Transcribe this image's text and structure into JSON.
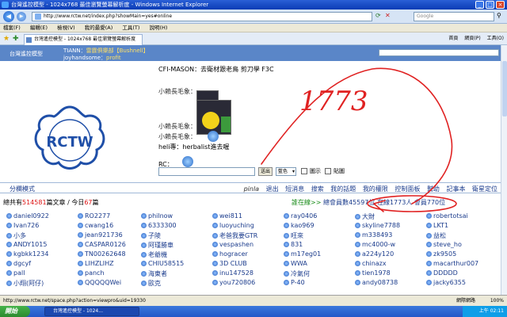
{
  "window": {
    "title": "台灣遙控模型 - 1024x768 最佳瀏覽螢幕解析度 - Windows Internet Explorer",
    "minimize": "_",
    "maximize": "□",
    "close": "×"
  },
  "address_bar": {
    "url": "http://www.rctw.net/index.php?showMain=yes#online",
    "search_placeholder": "Google"
  },
  "menu": [
    "檔案(F)",
    "編輯(E)",
    "檢視(V)",
    "我的最愛(A)",
    "工具(T)",
    "說明(H)"
  ],
  "tab": {
    "label": "台灣遙控模型 - 1024x768 最佳瀏覽螢幕解析度"
  },
  "toolbar": [
    "首頁",
    "網頁(P)",
    "工具(O)"
  ],
  "chat": {
    "header_title": "台灣遙控模型",
    "header_user1": "TIANN：",
    "header_msg1": "雷霆俱樂部【Bushnell】",
    "header_user2": "joyhandsome：",
    "header_msg2": "profit",
    "lines": [
      {
        "text": "CFI-MASON：去衛材跟老鳥 剪刀學 F3C"
      },
      {
        "text": "小賴長毛象："
      },
      {
        "text": "小賴長毛象："
      },
      {
        "text": "小賴長毛象："
      },
      {
        "text": "heli專：herbalist進去喔"
      },
      {
        "text": "RC："
      }
    ],
    "send_label": "送出",
    "color_label": "藍色",
    "opt1": "圖示",
    "opt2": "貼圖"
  },
  "nav": {
    "left": "分欄模式",
    "items": [
      "pinla",
      "退出",
      "短消息",
      "搜索",
      "我的話題",
      "我的權限",
      "控制面板",
      "幫助",
      "記事本",
      "衛星定位"
    ]
  },
  "stats": {
    "prefix": "總共有",
    "topics": "514581",
    "mid": "篇文章 / 今日",
    "today": "67",
    "suffix": "篇",
    "online_label": "誰在線>>",
    "online_total": "總會員數45597位",
    "online_now": "在線1773人",
    "online_members": "會員770位"
  },
  "users": [
    [
      "daniel0922",
      "RO2277",
      "philnow",
      "wei811",
      "ray0406",
      "大財",
      "robertotsai"
    ],
    [
      "Ivan726",
      "cwang16",
      "6333300",
      "luoyuching",
      "kao969",
      "skyline7788",
      "LKT1"
    ],
    [
      "小多",
      "jean921736",
      "子陵",
      "老爸我要GTR",
      "旺來",
      "m338493",
      "益松"
    ],
    [
      "ANDY1015",
      "CASPAR0126",
      "阿瑾勝車",
      "vespashen",
      "831",
      "mc4000-w",
      "steve_ho"
    ],
    [
      "kgbkk1234",
      "TN00262648",
      "老爺機",
      "hogracer",
      "m17eg01",
      "a224y120",
      "zk9505"
    ],
    [
      "dgcyf",
      "LIHZLIHZ",
      "CHIU58515",
      "3D CLUB",
      "WWA",
      "chinazx",
      "macarthur007"
    ],
    [
      "pall",
      "panch",
      "海東者",
      "inu147528",
      "冷氣何",
      "tien1978",
      "DDDDD"
    ],
    [
      "小翔(阿仔)",
      "QQQQQWei",
      "歐克",
      "you720806",
      "P-40",
      "andy08738",
      "jacky6355"
    ]
  ],
  "annotation": {
    "text": "1773"
  },
  "status": {
    "url": "http://www.rctw.net/space.php?action=viewpro&uid=19330",
    "zone": "網際網路",
    "zoom": "100%"
  },
  "taskbar": {
    "start": "開始",
    "item": "台灣遙控模型 - 1024...",
    "clock": "上午 02:11"
  },
  "colors": {
    "accent": "#5a86c8",
    "annotation": "#e02222",
    "link": "#1a3b8c"
  }
}
